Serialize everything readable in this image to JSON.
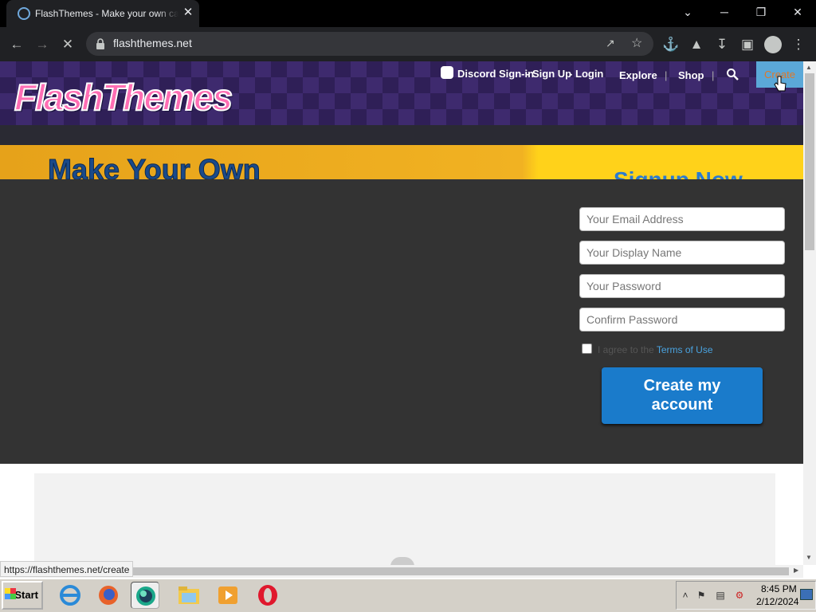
{
  "browser": {
    "tab_title": "FlashThemes - Make your own cartoons",
    "tab_close": "✕",
    "url": "flashthemes.net",
    "window_controls": {
      "minimize": "─",
      "restore": "❐",
      "close": "✕",
      "tab_list": "⌄"
    },
    "icons": {
      "back": "back-arrow-icon",
      "forward": "forward-arrow-icon",
      "stop": "stop-icon",
      "share": "share-icon",
      "bookmark": "star-icon",
      "extensions": "puzzle-icon",
      "labs": "flask-icon",
      "download": "download-icon",
      "sidepanel": "sidepanel-icon",
      "profile": "profile-icon",
      "menu": "kebab-menu-icon"
    },
    "status_url": "https://flashthemes.net/create"
  },
  "site": {
    "logo_text": "FlashThemes",
    "nav": {
      "discord": "Discord Sign-in",
      "signup": "Sign Up",
      "login": "Login",
      "explore": "Explore",
      "shop": "Shop",
      "create": "Create",
      "sep_dash": "-",
      "sep_bar": "|"
    },
    "banner": {
      "title": "Make Your Own",
      "subtitle": "Signup Now"
    },
    "signup_form": {
      "email_placeholder": "Your Email Address",
      "display_name_placeholder": "Your Display Name",
      "password_placeholder": "Your Password",
      "confirm_placeholder": "Confirm Password",
      "agree_text": "I agree to the",
      "terms_link": "Terms of Use",
      "submit_line1": "Create my",
      "submit_line2": "account"
    }
  },
  "taskbar": {
    "start_label": "Start",
    "apps": [
      "internet-explorer-icon",
      "firefox-icon",
      "browser-icon",
      "file-explorer-icon",
      "media-player-icon",
      "opera-icon"
    ],
    "clock_time": "8:45 PM",
    "clock_date": "2/12/2024"
  },
  "colors": {
    "accent_blue": "#1a7bcb",
    "header_purple": "#3e2a6e",
    "banner_orange": "#f1b222",
    "create_orange": "#e07828"
  }
}
